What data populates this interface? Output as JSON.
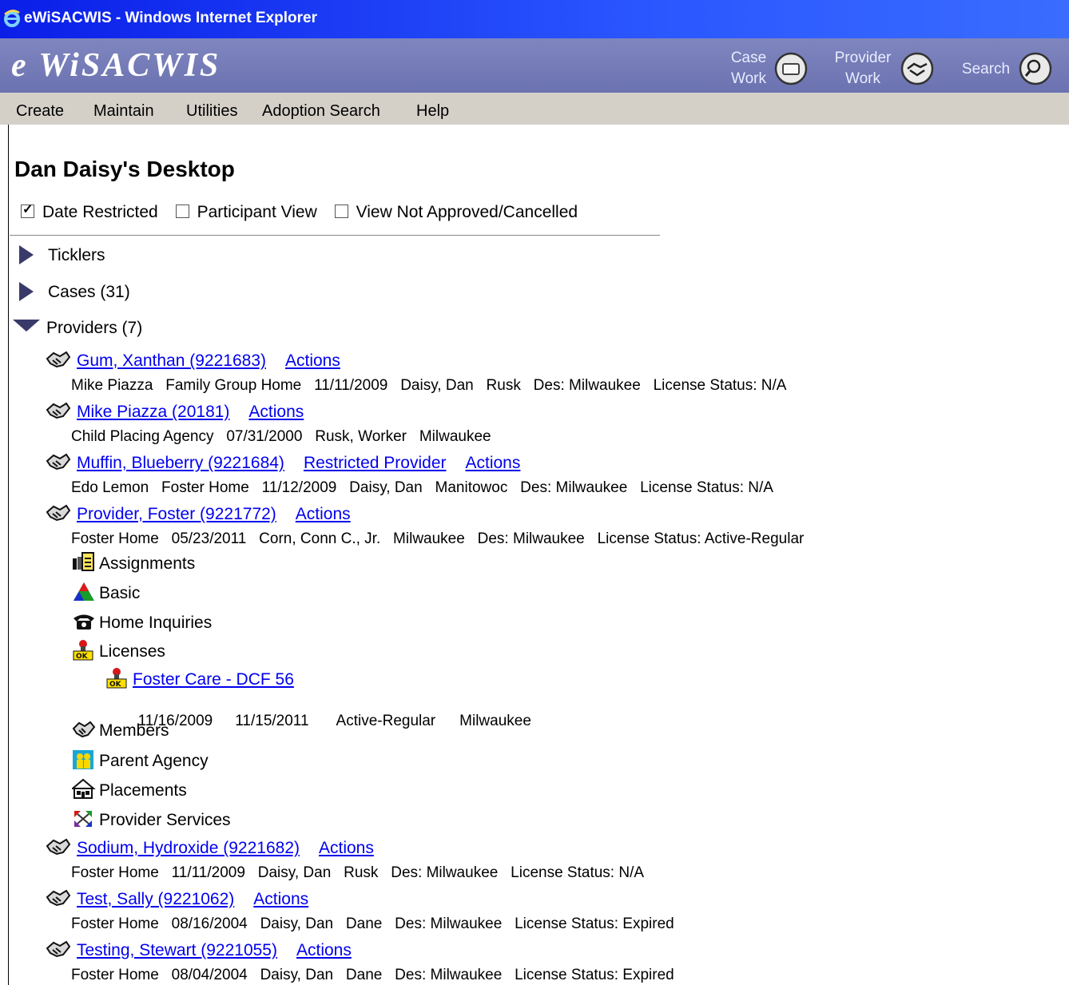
{
  "window": {
    "title": "eWiSACWIS - Windows Internet Explorer"
  },
  "banner": {
    "logo": "e WiSACWIS",
    "nav": [
      {
        "line1": "Case",
        "line2": "Work"
      },
      {
        "line1": "Provider",
        "line2": "Work"
      },
      {
        "line1": "Search",
        "line2": ""
      }
    ]
  },
  "menu": [
    "Create",
    "Maintain",
    "Utilities",
    "Adoption Search",
    "Help"
  ],
  "page": {
    "title": "Dan Daisy's Desktop"
  },
  "filters": [
    {
      "label": "Date Restricted",
      "checked": true
    },
    {
      "label": "Participant View",
      "checked": false
    },
    {
      "label": "View Not Approved/Cancelled",
      "checked": false
    }
  ],
  "tree": {
    "ticklers": "Ticklers",
    "cases": "Cases (31)",
    "providers": "Providers (7)"
  },
  "providers": [
    {
      "link": "Gum, Xanthan (9221683)",
      "extra": "",
      "actions": "Actions",
      "detail": "Mike Piazza   Family Group Home   11/11/2009   Daisy, Dan   Rusk   Des: Milwaukee   License Status: N/A"
    },
    {
      "link": "Mike Piazza (20181)",
      "extra": "",
      "actions": "Actions",
      "detail": "Child Placing Agency   07/31/2000   Rusk, Worker   Milwaukee"
    },
    {
      "link": "Muffin, Blueberry (9221684)",
      "extra": "Restricted Provider",
      "actions": "Actions",
      "detail": "Edo Lemon   Foster Home   11/12/2009   Daisy, Dan   Manitowoc   Des: Milwaukee   License Status: N/A"
    },
    {
      "link": "Provider, Foster (9221772)",
      "extra": "",
      "actions": "Actions",
      "detail": "Foster Home   05/23/2011   Corn, Conn C., Jr.   Milwaukee   Des: Milwaukee   License Status: Active-Regular"
    },
    {
      "link": "Sodium, Hydroxide (9221682)",
      "extra": "",
      "actions": "Actions",
      "detail": "Foster Home   11/11/2009   Daisy, Dan   Rusk   Des: Milwaukee   License Status: N/A"
    },
    {
      "link": "Test, Sally (9221062)",
      "extra": "",
      "actions": "Actions",
      "detail": "Foster Home   08/16/2004   Daisy, Dan   Dane   Des: Milwaukee   License Status: Expired"
    },
    {
      "link": "Testing, Stewart (9221055)",
      "extra": "",
      "actions": "Actions",
      "detail": "Foster Home   08/04/2004   Daisy, Dan   Dane   Des: Milwaukee   License Status: Expired"
    }
  ],
  "subitems": [
    {
      "label": "Assignments",
      "icon": "assignments-icon"
    },
    {
      "label": "Basic",
      "icon": "basic-triangle-icon"
    },
    {
      "label": "Home Inquiries",
      "icon": "telephone-icon"
    },
    {
      "label": "Licenses",
      "icon": "license-ok-icon"
    },
    {
      "label": "Members",
      "icon": "handshake-icon"
    },
    {
      "label": "Parent Agency",
      "icon": "parent-agency-icon"
    },
    {
      "label": "Placements",
      "icon": "house-icon"
    },
    {
      "label": "Provider Services",
      "icon": "arrows-icon"
    }
  ],
  "license": {
    "link": "Foster Care - DCF 56",
    "start": "11/16/2009",
    "end": "11/15/2011",
    "status": "Active-Regular",
    "county": "Milwaukee"
  }
}
